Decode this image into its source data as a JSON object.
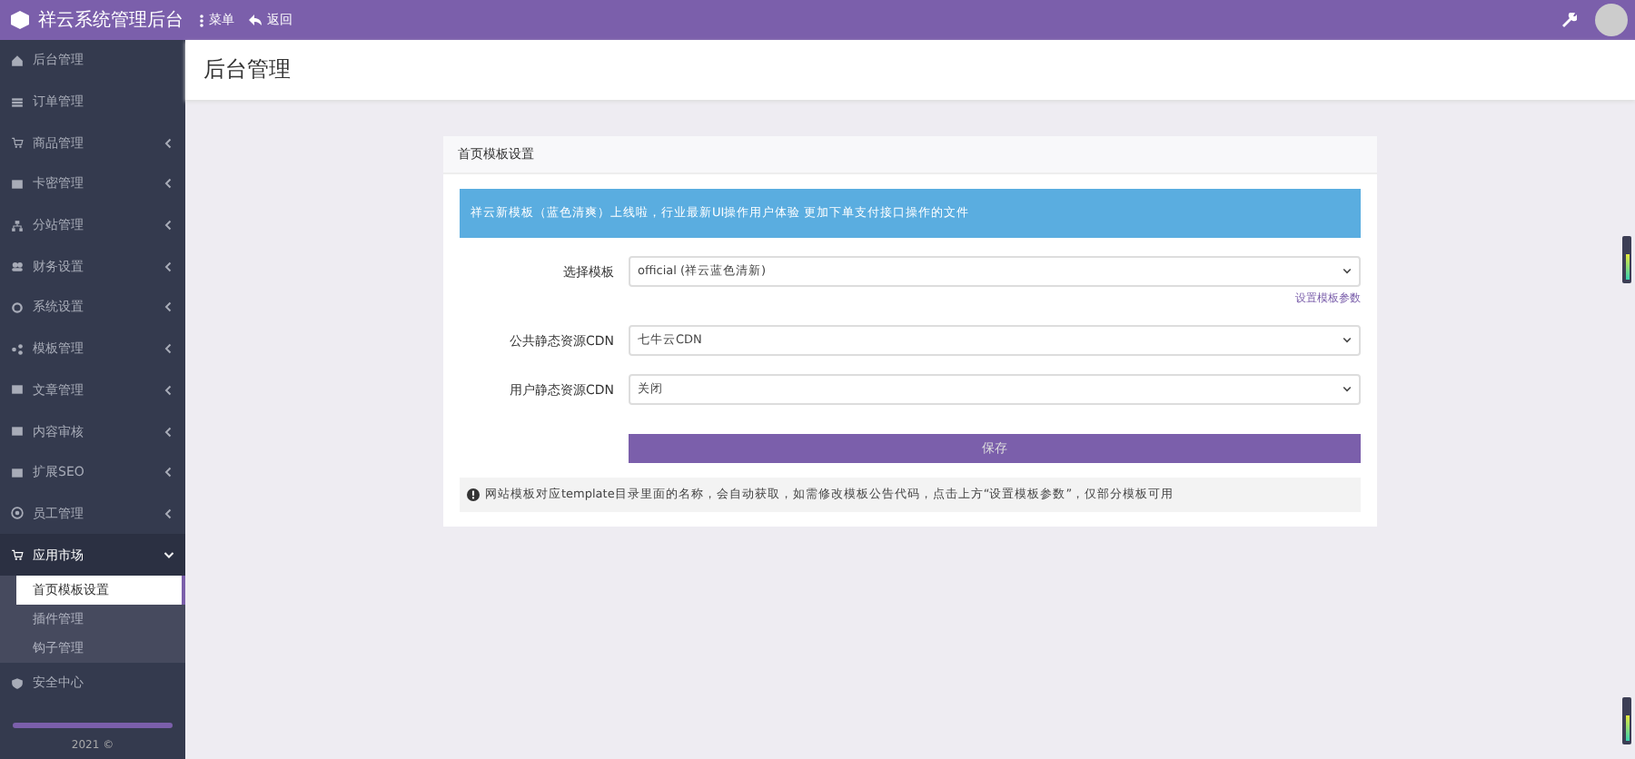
{
  "brand": {
    "title": "祥云系统管理后台"
  },
  "topbar": {
    "items": [
      {
        "label": "菜单",
        "kind": "menu"
      },
      {
        "label": "返回",
        "kind": "back"
      }
    ]
  },
  "page_title": "后台管理",
  "sidebar": {
    "items": [
      {
        "label": "后台管理",
        "expandable": false,
        "expanded": false
      },
      {
        "label": "订单管理",
        "expandable": false,
        "expanded": false
      },
      {
        "label": "商品管理",
        "expandable": true,
        "expanded": false
      },
      {
        "label": "卡密管理",
        "expandable": true,
        "expanded": false
      },
      {
        "label": "分站管理",
        "expandable": true,
        "expanded": false
      },
      {
        "label": "财务设置",
        "expandable": true,
        "expanded": false
      },
      {
        "label": "系统设置",
        "expandable": true,
        "expanded": false
      },
      {
        "label": "模板管理",
        "expandable": true,
        "expanded": false
      },
      {
        "label": "文章管理",
        "expandable": true,
        "expanded": false
      },
      {
        "label": "内容审核",
        "expandable": true,
        "expanded": false
      },
      {
        "label": "扩展SEO",
        "expandable": true,
        "expanded": false
      },
      {
        "label": "员工管理",
        "expandable": true,
        "expanded": false
      },
      {
        "label": "应用市场",
        "expandable": true,
        "expanded": true,
        "children": [
          {
            "label": "首页模板设置",
            "selected": true
          },
          {
            "label": "插件管理",
            "selected": false
          },
          {
            "label": "钩子管理",
            "selected": false
          }
        ]
      },
      {
        "label": "安全中心",
        "expandable": false,
        "expanded": false
      }
    ]
  },
  "footer": {
    "text": "2021 ©"
  },
  "card": {
    "title": "首页模板设置",
    "notice": "祥云新模板（蓝色清爽）上线啦，行业最新UI操作用户体验 更加下单支付接口操作的文件",
    "fields": [
      {
        "label": "选择模板",
        "value": "official (祥云蓝色清新)",
        "link": "设置模板参数"
      },
      {
        "label": "公共静态资源CDN",
        "value": "七牛云CDN"
      },
      {
        "label": "用户静态资源CDN",
        "value": "关闭"
      }
    ],
    "submit": "保存",
    "tip": "网站模板对应template目录里面的名称，会自动获取，如需修改模板公告代码，点击上方“设置模板参数”，仅部分模板可用"
  }
}
